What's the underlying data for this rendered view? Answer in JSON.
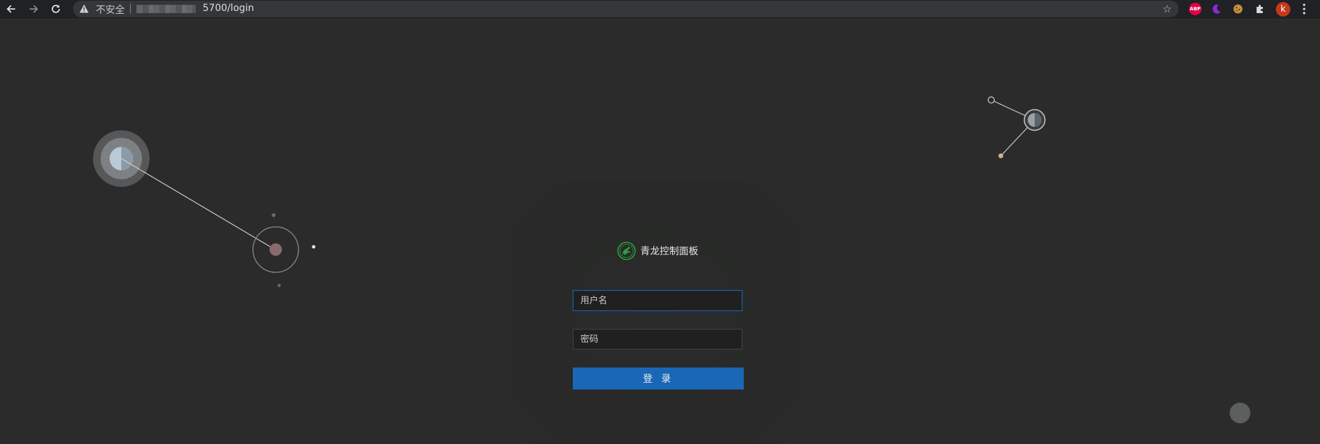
{
  "browser": {
    "security_label": "不安全",
    "separator": "|",
    "url_visible": "5700/login",
    "profile_initial": "k",
    "extensions": [
      {
        "name": "adblock-plus-icon",
        "label": "ABP",
        "color": "#e40046"
      },
      {
        "name": "dark-reader-icon",
        "label": "",
        "color": "#8b2bd9"
      },
      {
        "name": "cookie-icon",
        "label": "",
        "color": "#c58f3c"
      },
      {
        "name": "extensions-puzzle-icon",
        "label": "",
        "color": "#c8c8c8"
      }
    ]
  },
  "login": {
    "title": "青龙控制面板",
    "username_placeholder": "用户名",
    "password_placeholder": "密码",
    "submit_label": "登 录"
  },
  "colors": {
    "background": "#2a2b2a",
    "primary": "#1a67b6",
    "input_focus_border": "#1b5ea6",
    "logo_green": "#2aa23c"
  }
}
